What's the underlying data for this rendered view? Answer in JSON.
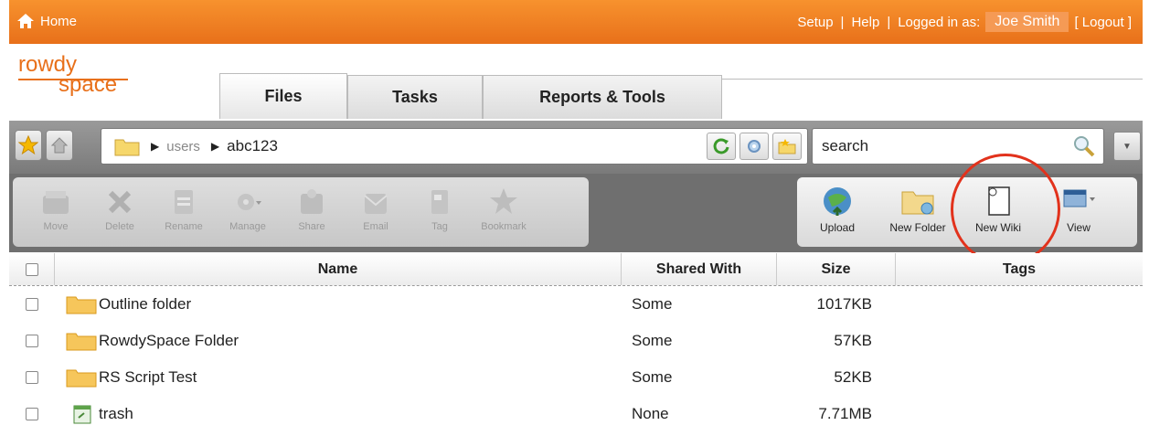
{
  "topbar": {
    "home_label": "Home",
    "setup_label": "Setup",
    "help_label": "Help",
    "sep": "|",
    "logged_in_label": "Logged in as:",
    "user_name": "Joe Smith",
    "logout_label": "[ Logout ]"
  },
  "logo": {
    "line1": "rowdy",
    "line2": "space"
  },
  "tabs": [
    {
      "label": "Files",
      "active": true
    },
    {
      "label": "Tasks",
      "active": false
    },
    {
      "label": "Reports & Tools",
      "active": false
    }
  ],
  "path": {
    "crumbs": [
      "users",
      "abc123"
    ],
    "search_placeholder": "search"
  },
  "toolbar": {
    "left": [
      "Move",
      "Delete",
      "Rename",
      "Manage",
      "Share",
      "Email",
      "Tag",
      "Bookmark"
    ],
    "right": [
      "Upload",
      "New Folder",
      "New Wiki",
      "View"
    ]
  },
  "table": {
    "headers": {
      "name": "Name",
      "shared": "Shared With",
      "size": "Size",
      "tags": "Tags"
    },
    "rows": [
      {
        "name": "Outline folder",
        "shared": "Some",
        "size": "1017KB",
        "icon": "folder-icon"
      },
      {
        "name": "RowdySpace Folder",
        "shared": "Some",
        "size": "57KB",
        "icon": "folder-icon"
      },
      {
        "name": "RS Script Test",
        "shared": "Some",
        "size": "52KB",
        "icon": "folder-icon"
      },
      {
        "name": "trash",
        "shared": "None",
        "size": "7.71MB",
        "icon": "trash-icon"
      }
    ]
  },
  "colors": {
    "accent": "#e8701a",
    "annotation": "#e2321c"
  }
}
